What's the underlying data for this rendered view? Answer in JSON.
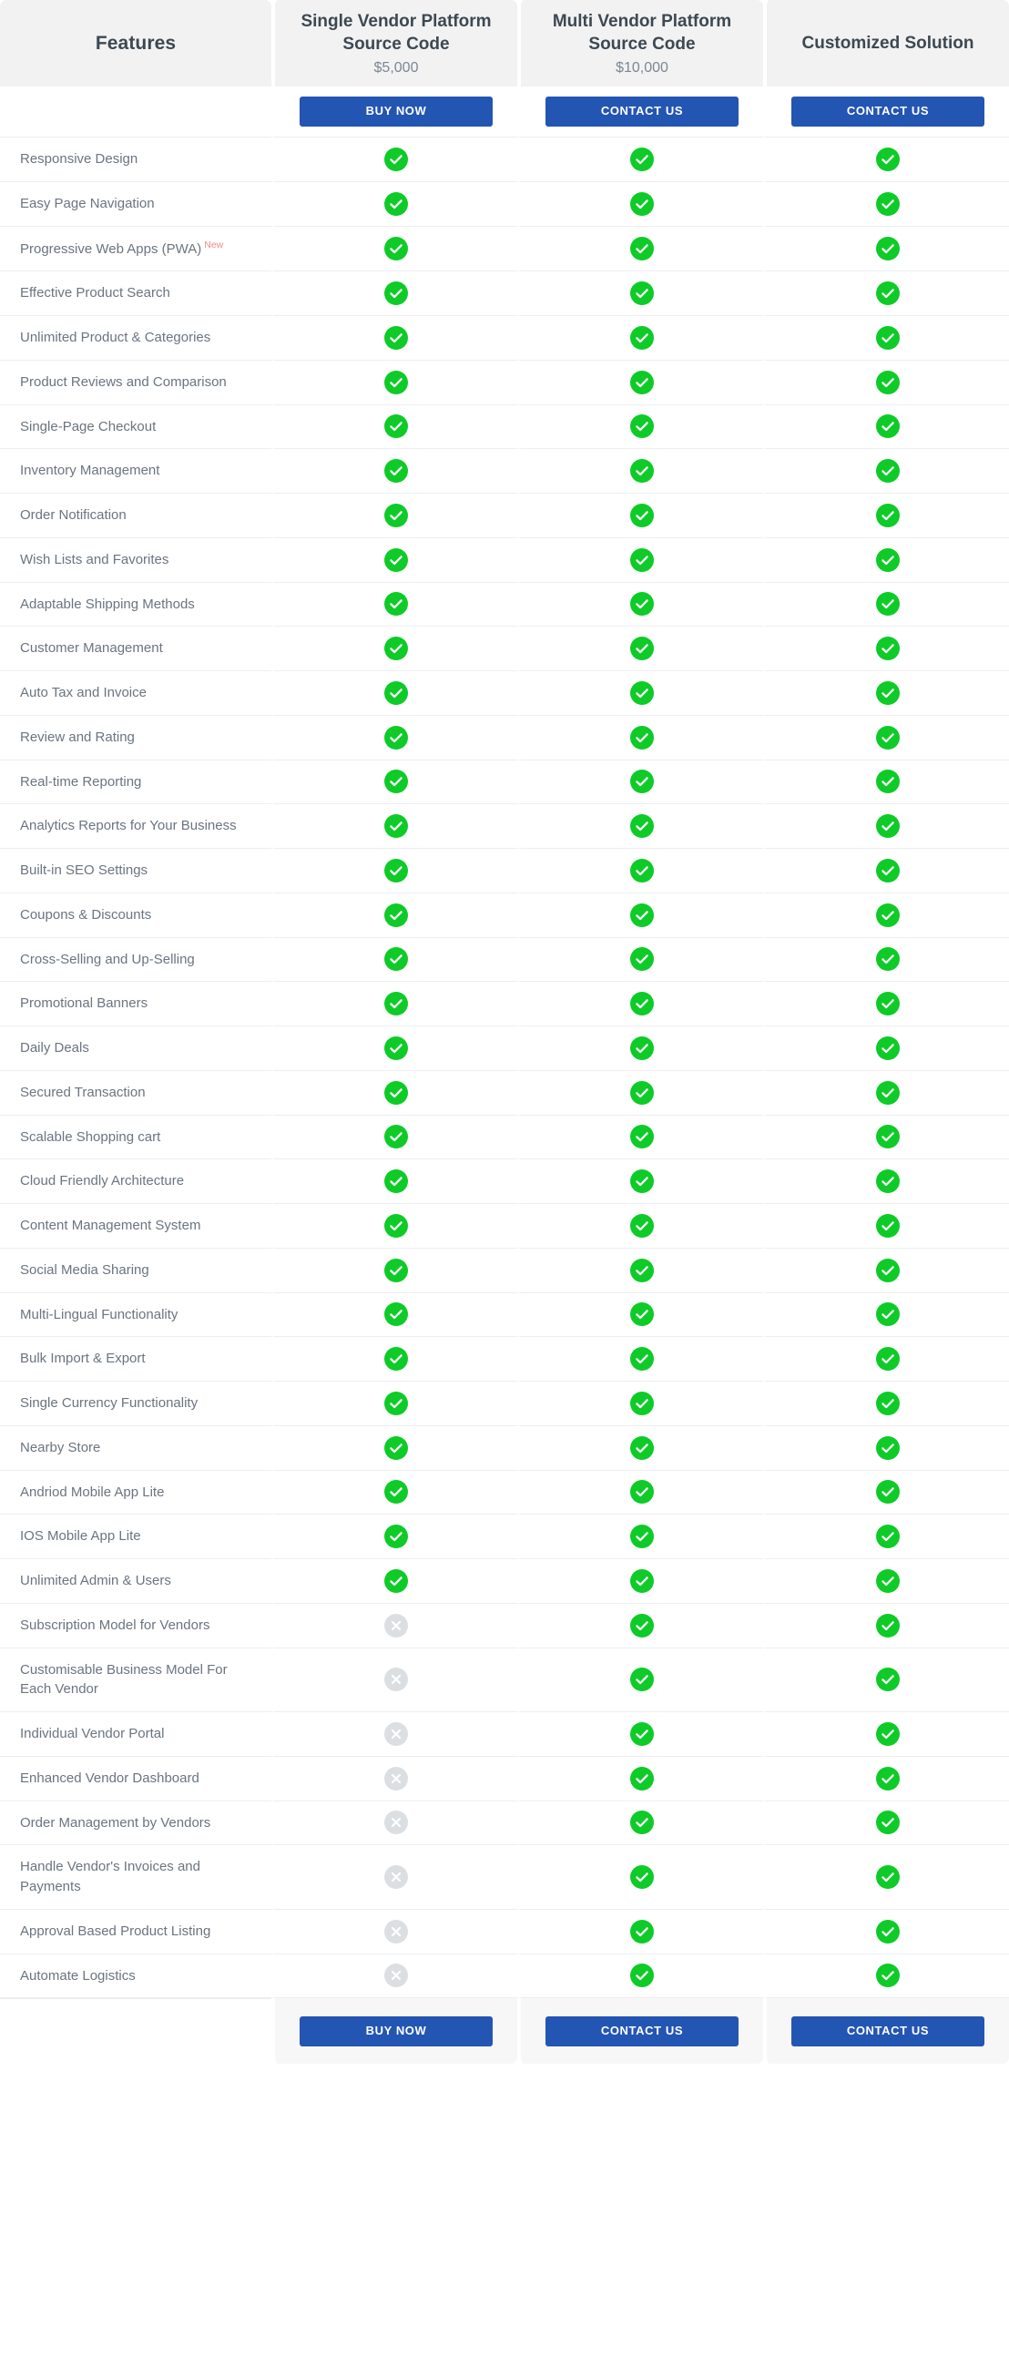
{
  "theme": {
    "accent_blue": "#2355b3",
    "yes_green": "#0ecb28",
    "no_gray": "#dcdfe2",
    "header_bg": "#f2f2f2",
    "text_gray": "#6b7480",
    "badge_red": "#f08a8a"
  },
  "header": {
    "feature_column_label": "Features",
    "plans": [
      {
        "title_line1": "Single Vendor Platform",
        "title_line2": "Source Code",
        "price": "$5,000",
        "cta_label": "BUY NOW"
      },
      {
        "title_line1": "Multi Vendor Platform",
        "title_line2": "Source Code",
        "price": "$10,000",
        "cta_label": "CONTACT US"
      },
      {
        "title_line1": "Customized Solution",
        "title_line2": "",
        "price": "",
        "cta_label": "CONTACT US"
      }
    ]
  },
  "icons": {
    "yes": "check-circle-icon",
    "no": "cross-circle-icon"
  },
  "footer": {
    "plans": [
      {
        "cta_label": "BUY NOW"
      },
      {
        "cta_label": "CONTACT US"
      },
      {
        "cta_label": "CONTACT US"
      }
    ]
  },
  "chart_data": {
    "type": "table",
    "title": "Plan Feature Comparison",
    "columns": [
      "Features",
      "Single Vendor Platform Source Code",
      "Multi Vendor Platform Source Code",
      "Customized Solution"
    ],
    "rows": [
      {
        "feature": "Responsive Design",
        "badge": "",
        "values": [
          true,
          true,
          true
        ]
      },
      {
        "feature": "Easy Page Navigation",
        "badge": "",
        "values": [
          true,
          true,
          true
        ]
      },
      {
        "feature": "Progressive Web Apps (PWA)",
        "badge": "New",
        "values": [
          true,
          true,
          true
        ]
      },
      {
        "feature": "Effective Product Search",
        "badge": "",
        "values": [
          true,
          true,
          true
        ]
      },
      {
        "feature": "Unlimited Product & Categories",
        "badge": "",
        "values": [
          true,
          true,
          true
        ]
      },
      {
        "feature": "Product Reviews and Comparison",
        "badge": "",
        "values": [
          true,
          true,
          true
        ]
      },
      {
        "feature": "Single-Page Checkout",
        "badge": "",
        "values": [
          true,
          true,
          true
        ]
      },
      {
        "feature": "Inventory Management",
        "badge": "",
        "values": [
          true,
          true,
          true
        ]
      },
      {
        "feature": "Order Notification",
        "badge": "",
        "values": [
          true,
          true,
          true
        ]
      },
      {
        "feature": "Wish Lists and Favorites",
        "badge": "",
        "values": [
          true,
          true,
          true
        ]
      },
      {
        "feature": "Adaptable Shipping Methods",
        "badge": "",
        "values": [
          true,
          true,
          true
        ]
      },
      {
        "feature": "Customer Management",
        "badge": "",
        "values": [
          true,
          true,
          true
        ]
      },
      {
        "feature": "Auto Tax and Invoice",
        "badge": "",
        "values": [
          true,
          true,
          true
        ]
      },
      {
        "feature": "Review and Rating",
        "badge": "",
        "values": [
          true,
          true,
          true
        ]
      },
      {
        "feature": "Real-time Reporting",
        "badge": "",
        "values": [
          true,
          true,
          true
        ]
      },
      {
        "feature": "Analytics Reports for Your Business",
        "badge": "",
        "values": [
          true,
          true,
          true
        ]
      },
      {
        "feature": "Built-in SEO Settings",
        "badge": "",
        "values": [
          true,
          true,
          true
        ]
      },
      {
        "feature": "Coupons & Discounts",
        "badge": "",
        "values": [
          true,
          true,
          true
        ]
      },
      {
        "feature": "Cross-Selling and Up-Selling",
        "badge": "",
        "values": [
          true,
          true,
          true
        ]
      },
      {
        "feature": "Promotional Banners",
        "badge": "",
        "values": [
          true,
          true,
          true
        ]
      },
      {
        "feature": "Daily Deals",
        "badge": "",
        "values": [
          true,
          true,
          true
        ]
      },
      {
        "feature": "Secured Transaction",
        "badge": "",
        "values": [
          true,
          true,
          true
        ]
      },
      {
        "feature": "Scalable Shopping cart",
        "badge": "",
        "values": [
          true,
          true,
          true
        ]
      },
      {
        "feature": "Cloud Friendly Architecture",
        "badge": "",
        "values": [
          true,
          true,
          true
        ]
      },
      {
        "feature": "Content Management System",
        "badge": "",
        "values": [
          true,
          true,
          true
        ]
      },
      {
        "feature": "Social Media Sharing",
        "badge": "",
        "values": [
          true,
          true,
          true
        ]
      },
      {
        "feature": "Multi-Lingual Functionality",
        "badge": "",
        "values": [
          true,
          true,
          true
        ]
      },
      {
        "feature": "Bulk Import & Export",
        "badge": "",
        "values": [
          true,
          true,
          true
        ]
      },
      {
        "feature": "Single Currency Functionality",
        "badge": "",
        "values": [
          true,
          true,
          true
        ]
      },
      {
        "feature": "Nearby Store",
        "badge": "",
        "values": [
          true,
          true,
          true
        ]
      },
      {
        "feature": "Andriod Mobile App Lite",
        "badge": "",
        "values": [
          true,
          true,
          true
        ]
      },
      {
        "feature": "IOS  Mobile App Lite",
        "badge": "",
        "values": [
          true,
          true,
          true
        ]
      },
      {
        "feature": "Unlimited Admin & Users",
        "badge": "",
        "values": [
          true,
          true,
          true
        ]
      },
      {
        "feature": "Subscription Model for Vendors",
        "badge": "",
        "values": [
          false,
          true,
          true
        ]
      },
      {
        "feature": "Customisable Business Model For Each Vendor",
        "badge": "",
        "values": [
          false,
          true,
          true
        ]
      },
      {
        "feature": "Individual Vendor Portal",
        "badge": "",
        "values": [
          false,
          true,
          true
        ]
      },
      {
        "feature": "Enhanced Vendor Dashboard",
        "badge": "",
        "values": [
          false,
          true,
          true
        ]
      },
      {
        "feature": "Order Management by Vendors",
        "badge": "",
        "values": [
          false,
          true,
          true
        ]
      },
      {
        "feature": "Handle Vendor's Invoices and Payments",
        "badge": "",
        "values": [
          false,
          true,
          true
        ]
      },
      {
        "feature": "Approval Based Product Listing",
        "badge": "",
        "values": [
          false,
          true,
          true
        ]
      },
      {
        "feature": "Automate Logistics",
        "badge": "",
        "values": [
          false,
          true,
          true
        ]
      }
    ]
  }
}
